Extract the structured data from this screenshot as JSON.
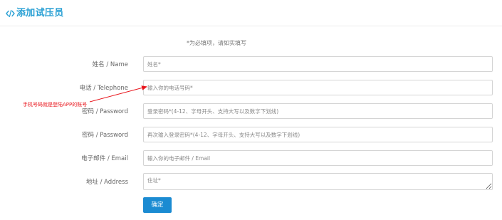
{
  "header": {
    "icon": "code-icon",
    "title": "添加试压员"
  },
  "form": {
    "required_note": "*为必填项，请如实填写",
    "name": {
      "label": "姓名 / Name",
      "placeholder": "姓名*"
    },
    "telephone": {
      "label": "电话 / Telephone",
      "placeholder": "输入你的电话号码*"
    },
    "password": {
      "label": "密码 / Password",
      "placeholder": "登录密码*(4-12、字母开头、支持大写以及数字下划线)"
    },
    "password_confirm": {
      "label": "密码 / Password",
      "placeholder": "再次输入登录密码*(4-12、字母开头、支持大写以及数字下划线)"
    },
    "email": {
      "label": "电子邮件 / Email",
      "placeholder": "输入你的电子邮件 / Email"
    },
    "address": {
      "label": "地址 / Address",
      "placeholder": "住址*"
    },
    "submit_label": "确定"
  },
  "annotation": {
    "text": "手机号码就是登陆APP的账号",
    "color": "#e8141b"
  },
  "colors": {
    "accent": "#29a0d4",
    "button": "#1b8bd2"
  }
}
